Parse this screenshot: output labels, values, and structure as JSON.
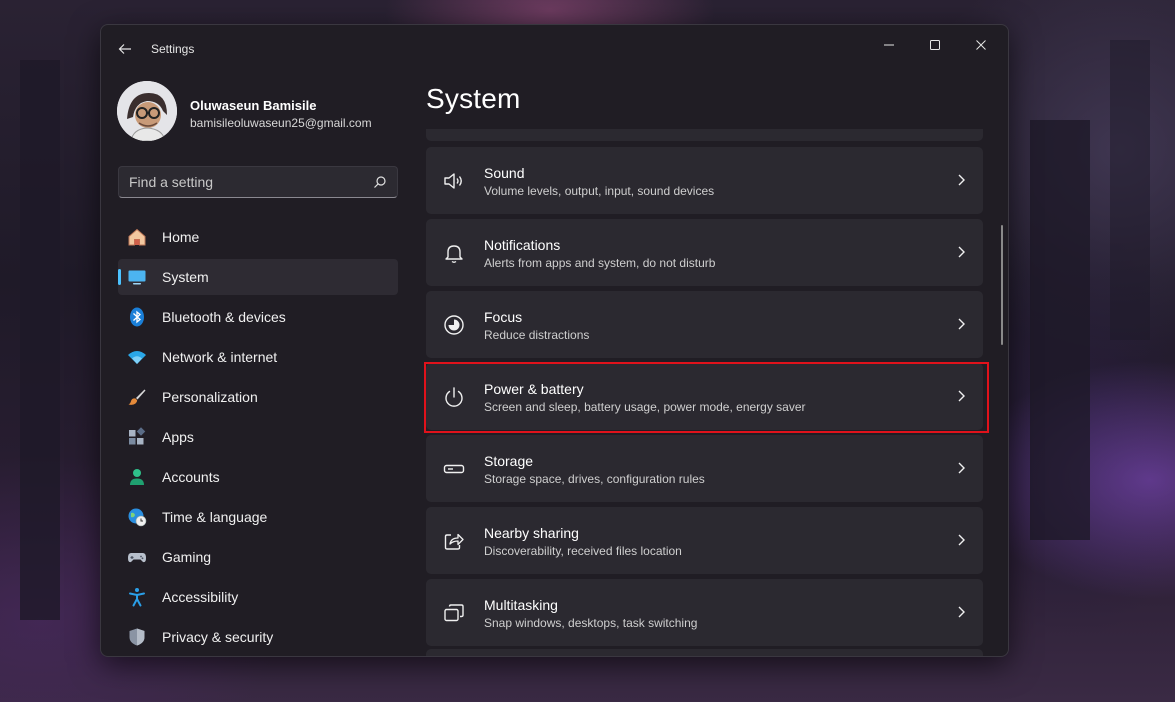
{
  "window": {
    "title": "Settings"
  },
  "profile": {
    "name": "Oluwaseun Bamisile",
    "email": "bamisileoluwaseun25@gmail.com"
  },
  "search": {
    "placeholder": "Find a setting"
  },
  "nav": {
    "items": [
      {
        "label": "Home",
        "icon": "home-icon"
      },
      {
        "label": "System",
        "icon": "system-icon",
        "selected": true
      },
      {
        "label": "Bluetooth & devices",
        "icon": "bluetooth-icon"
      },
      {
        "label": "Network & internet",
        "icon": "wifi-icon"
      },
      {
        "label": "Personalization",
        "icon": "brush-icon"
      },
      {
        "label": "Apps",
        "icon": "apps-icon"
      },
      {
        "label": "Accounts",
        "icon": "accounts-icon"
      },
      {
        "label": "Time & language",
        "icon": "globe-clock-icon"
      },
      {
        "label": "Gaming",
        "icon": "gamepad-icon"
      },
      {
        "label": "Accessibility",
        "icon": "accessibility-icon"
      },
      {
        "label": "Privacy & security",
        "icon": "shield-icon"
      }
    ]
  },
  "page": {
    "title": "System"
  },
  "settings": [
    {
      "title": "Sound",
      "description": "Volume levels, output, input, sound devices",
      "icon": "speaker-icon"
    },
    {
      "title": "Notifications",
      "description": "Alerts from apps and system, do not disturb",
      "icon": "bell-icon"
    },
    {
      "title": "Focus",
      "description": "Reduce distractions",
      "icon": "focus-icon"
    },
    {
      "title": "Power & battery",
      "description": "Screen and sleep, battery usage, power mode, energy saver",
      "icon": "power-icon",
      "highlighted": true
    },
    {
      "title": "Storage",
      "description": "Storage space, drives, configuration rules",
      "icon": "storage-icon"
    },
    {
      "title": "Nearby sharing",
      "description": "Discoverability, received files location",
      "icon": "share-icon"
    },
    {
      "title": "Multitasking",
      "description": "Snap windows, desktops, task switching",
      "icon": "multitasking-icon"
    }
  ],
  "colors": {
    "accent": "#4cc2ff",
    "highlight": "#e0121b",
    "window_bg": "#201d24",
    "card_bg": "#2b2930"
  }
}
